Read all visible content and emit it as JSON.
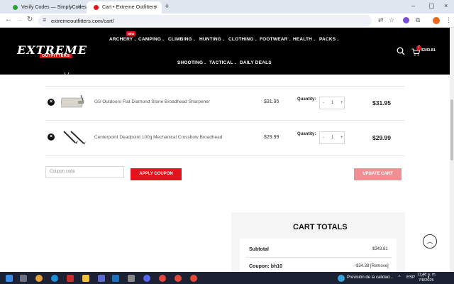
{
  "browser": {
    "tabs": [
      {
        "title": "Verify Codes — SimplyCodes",
        "active": false
      },
      {
        "title": "Cart • Extreme Outfitters",
        "active": true
      }
    ],
    "url": "extremeoutfitters.com/cart/"
  },
  "site": {
    "logo_main": "EXTREME",
    "logo_sub": "OUTFITTERS",
    "new_badge": "NEW",
    "menu_row1": [
      {
        "label": "ARCHERY"
      },
      {
        "label": "CAMPING"
      },
      {
        "label": "CLIMBING"
      },
      {
        "label": "HUNTING"
      },
      {
        "label": "CLOTHING"
      },
      {
        "label": "FOOTWEAR"
      },
      {
        "label": "HEALTH"
      },
      {
        "label": "PACKS"
      }
    ],
    "menu_row2": [
      {
        "label": "SHOOTING"
      },
      {
        "label": "TACTICAL"
      },
      {
        "label": "DAILY DEALS"
      }
    ],
    "cart_count": "7",
    "cart_total": "$343.81"
  },
  "cart": {
    "items": [
      {
        "name": "GS Outdoors Flat Diamond Stone Broadhead Sharpener",
        "price": "$31.95",
        "qty": "1",
        "subtotal": "$31.95"
      },
      {
        "name": "Centerpoint Deadpoint 100g Mechanical Crossbow Broadhead",
        "price": "$29.99",
        "qty": "1",
        "subtotal": "$29.99"
      }
    ],
    "quantity_label": "Quantity:",
    "coupon_placeholder": "Coupon code",
    "apply_label": "APPLY COUPON",
    "update_label": "UPDATE CART"
  },
  "totals": {
    "title": "CART TOTALS",
    "subtotal_label": "Subtotal",
    "subtotal_value": "$343.81",
    "coupon_label": "Coupon: bh10",
    "coupon_value": "-$34.38 [Remove]"
  },
  "taskbar": {
    "weather": "Previsión de la calidad...",
    "lang": "ESP",
    "time": "11:48 a. m.",
    "date": "7/8/2025"
  },
  "colors": {
    "accent": "#e1141d",
    "header_bg": "#000000"
  }
}
